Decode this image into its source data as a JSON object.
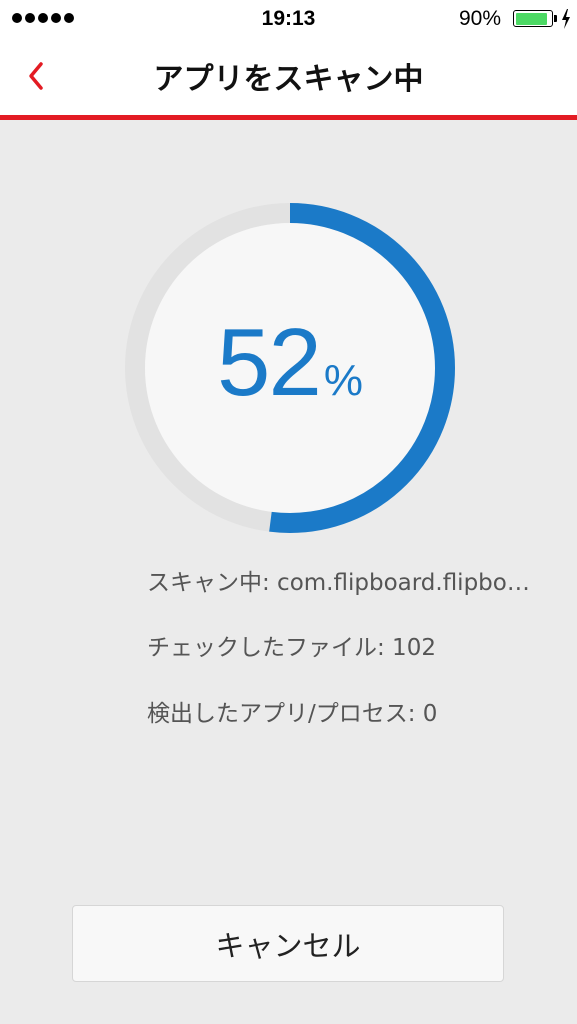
{
  "status_bar": {
    "time": "19:13",
    "battery_percent": "90%",
    "battery_level": 0.9,
    "signal_bars": 5,
    "charging": true
  },
  "nav": {
    "title": "アプリをスキャン中",
    "back_icon": "chevron-left-icon",
    "accent_color": "#e31b23"
  },
  "progress": {
    "value": "52",
    "unit": "%",
    "fraction": 0.52,
    "color": "#1b7ac8",
    "track_color": "#e2e2e2"
  },
  "info": {
    "scanning": "スキャン中: com.flipboard.flipbo…",
    "files_checked": "チェックしたファイル: 102",
    "detected": "検出したアプリ/プロセス: 0"
  },
  "cancel_label": "キャンセル"
}
